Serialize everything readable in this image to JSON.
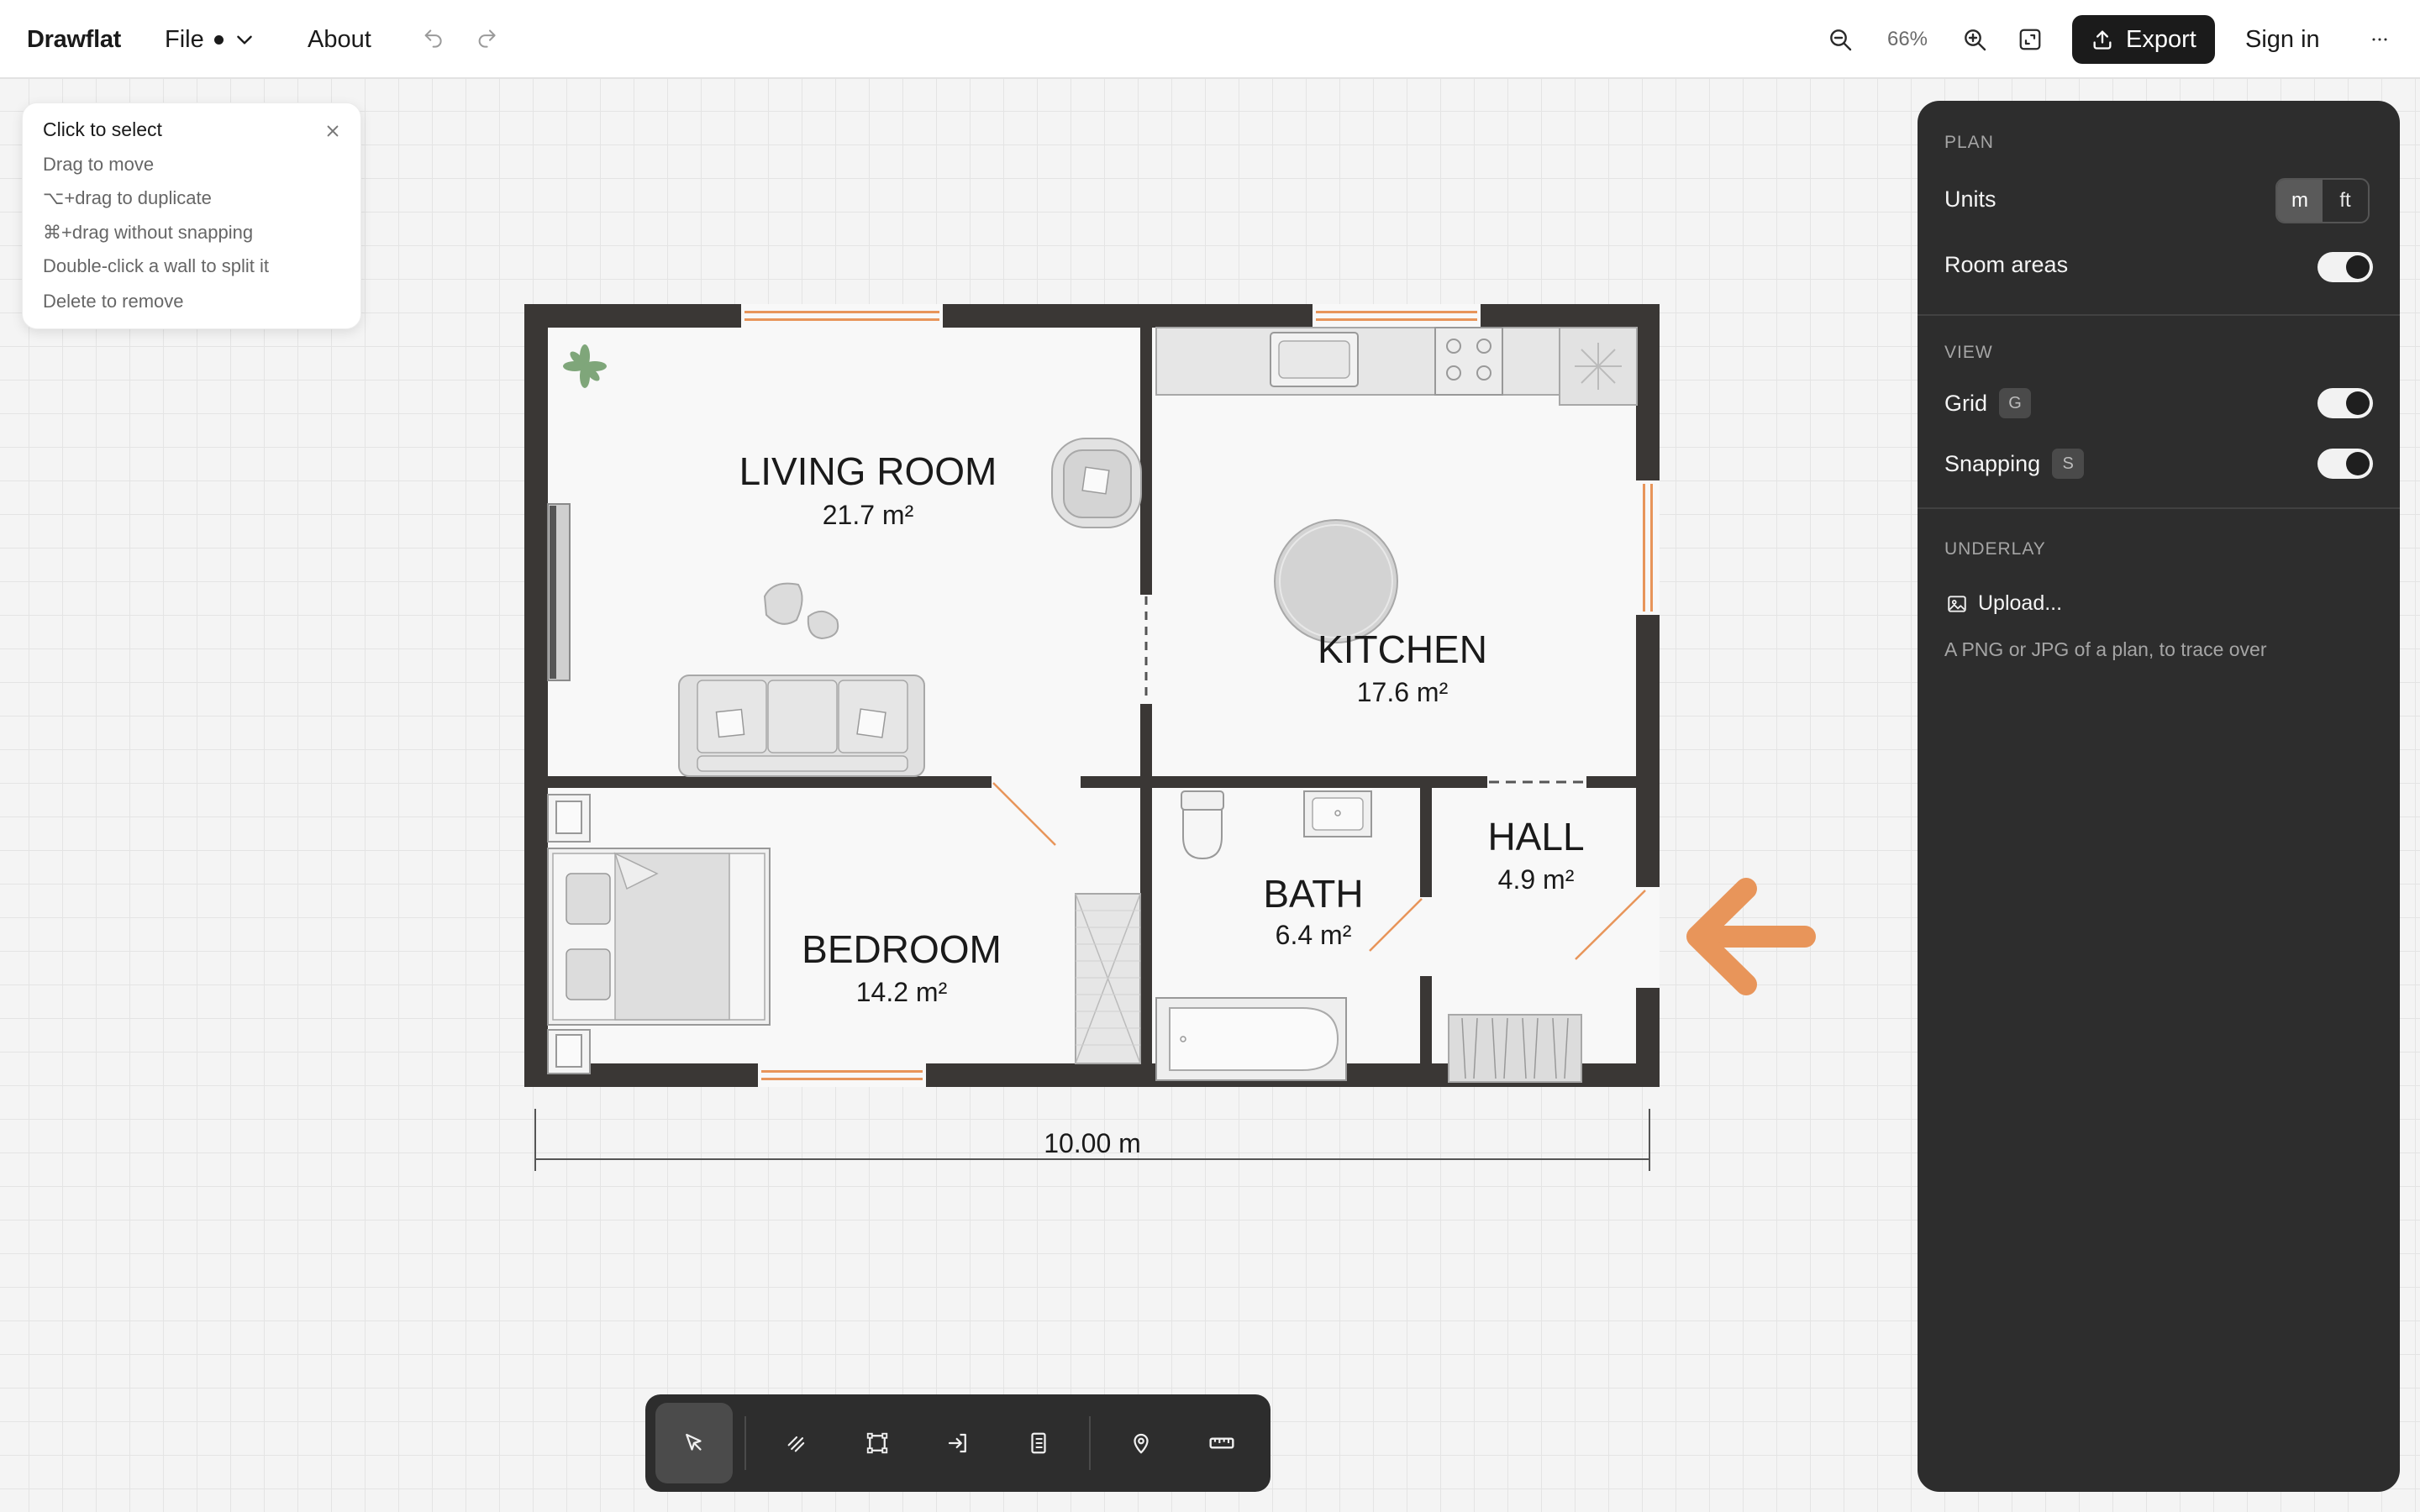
{
  "app": {
    "name": "Drawflat"
  },
  "header": {
    "file_label": "File",
    "about_label": "About",
    "zoom": "66%",
    "export_label": "Export",
    "signin_label": "Sign in"
  },
  "tips": {
    "items": [
      "Click to select",
      "Drag to move",
      "⌥+drag to duplicate",
      "⌘+drag without snapping",
      "Double-click a wall to split it",
      "Delete to remove"
    ]
  },
  "plan": {
    "rooms": [
      {
        "name": "LIVING ROOM",
        "area": "21.7 m²"
      },
      {
        "name": "KITCHEN",
        "area": "17.6 m²"
      },
      {
        "name": "BEDROOM",
        "area": "14.2 m²"
      },
      {
        "name": "BATH",
        "area": "6.4 m²"
      },
      {
        "name": "HALL",
        "area": "4.9 m²"
      }
    ],
    "dimension": "10.00 m",
    "colors": {
      "wall": "#3a3735",
      "floor": "#f8f8f8",
      "window": "#e8955a",
      "accent": "#e8955a"
    }
  },
  "panel": {
    "plan_section": "PLAN",
    "units_label": "Units",
    "unit_m": "m",
    "unit_ft": "ft",
    "selected_unit": "m",
    "room_areas_label": "Room areas",
    "room_areas_on": true,
    "view_section": "VIEW",
    "grid_label": "Grid",
    "grid_key": "G",
    "grid_on": true,
    "snapping_label": "Snapping",
    "snapping_key": "S",
    "snapping_on": true,
    "underlay_section": "UNDERLAY",
    "upload_label": "Upload...",
    "upload_hint": "A PNG or JPG of a plan, to trace over"
  },
  "toolbar": {
    "tools": [
      "select-tool",
      "wall-tool",
      "room-tool",
      "door-tool",
      "window-tool",
      "marker-tool",
      "measure-tool"
    ],
    "active": "select-tool"
  }
}
